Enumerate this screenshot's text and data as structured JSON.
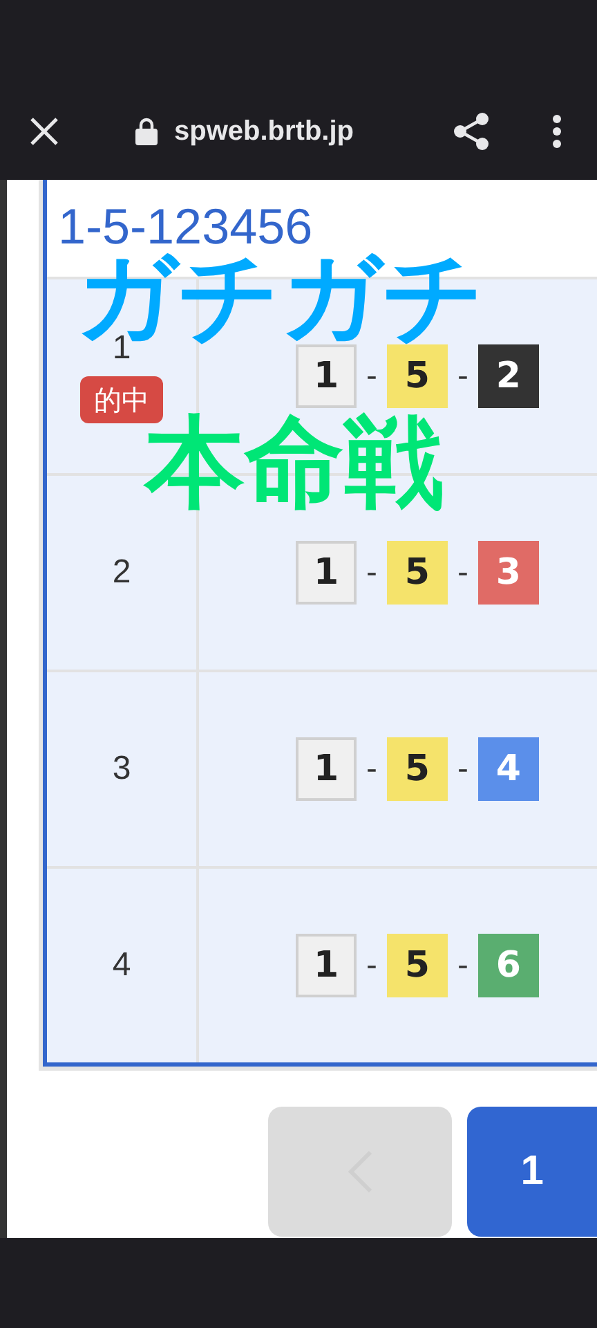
{
  "browser_bar": {
    "url": "spweb.brtb.jp"
  },
  "panel": {
    "title": "1-5-123456",
    "rows": [
      {
        "rank": "1",
        "hit_badge": "的中",
        "combo": [
          {
            "kind": "ball",
            "label": "1",
            "color": "#f0f0f0"
          },
          {
            "kind": "dash",
            "label": "-"
          },
          {
            "kind": "ball",
            "label": "5",
            "color": "#f5e36b"
          },
          {
            "kind": "dash",
            "label": "-"
          },
          {
            "kind": "ball",
            "label": "2",
            "color": "#333333"
          }
        ]
      },
      {
        "rank": "2",
        "combo": [
          {
            "kind": "ball",
            "label": "1",
            "color": "#f0f0f0"
          },
          {
            "kind": "dash",
            "label": "-"
          },
          {
            "kind": "ball",
            "label": "5",
            "color": "#f5e36b"
          },
          {
            "kind": "dash",
            "label": "-"
          },
          {
            "kind": "ball",
            "label": "3",
            "color": "#e06b66"
          }
        ]
      },
      {
        "rank": "3",
        "combo": [
          {
            "kind": "ball",
            "label": "1",
            "color": "#f0f0f0"
          },
          {
            "kind": "dash",
            "label": "-"
          },
          {
            "kind": "ball",
            "label": "5",
            "color": "#f5e36b"
          },
          {
            "kind": "dash",
            "label": "-"
          },
          {
            "kind": "ball",
            "label": "4",
            "color": "#5b8fea"
          }
        ]
      },
      {
        "rank": "4",
        "combo": [
          {
            "kind": "ball",
            "label": "1",
            "color": "#f0f0f0"
          },
          {
            "kind": "dash",
            "label": "-"
          },
          {
            "kind": "ball",
            "label": "5",
            "color": "#f5e36b"
          },
          {
            "kind": "dash",
            "label": "-"
          },
          {
            "kind": "ball",
            "label": "6",
            "color": "#5aae70"
          }
        ]
      }
    ]
  },
  "overlay_captions": [
    {
      "text": "ガチガチ",
      "color": "#00aaff"
    },
    {
      "text": "本命戦",
      "color": "#00e676"
    }
  ],
  "pager": {
    "prev": {
      "disabled": true
    },
    "pages": [
      {
        "label": "1",
        "selected": true
      }
    ]
  }
}
